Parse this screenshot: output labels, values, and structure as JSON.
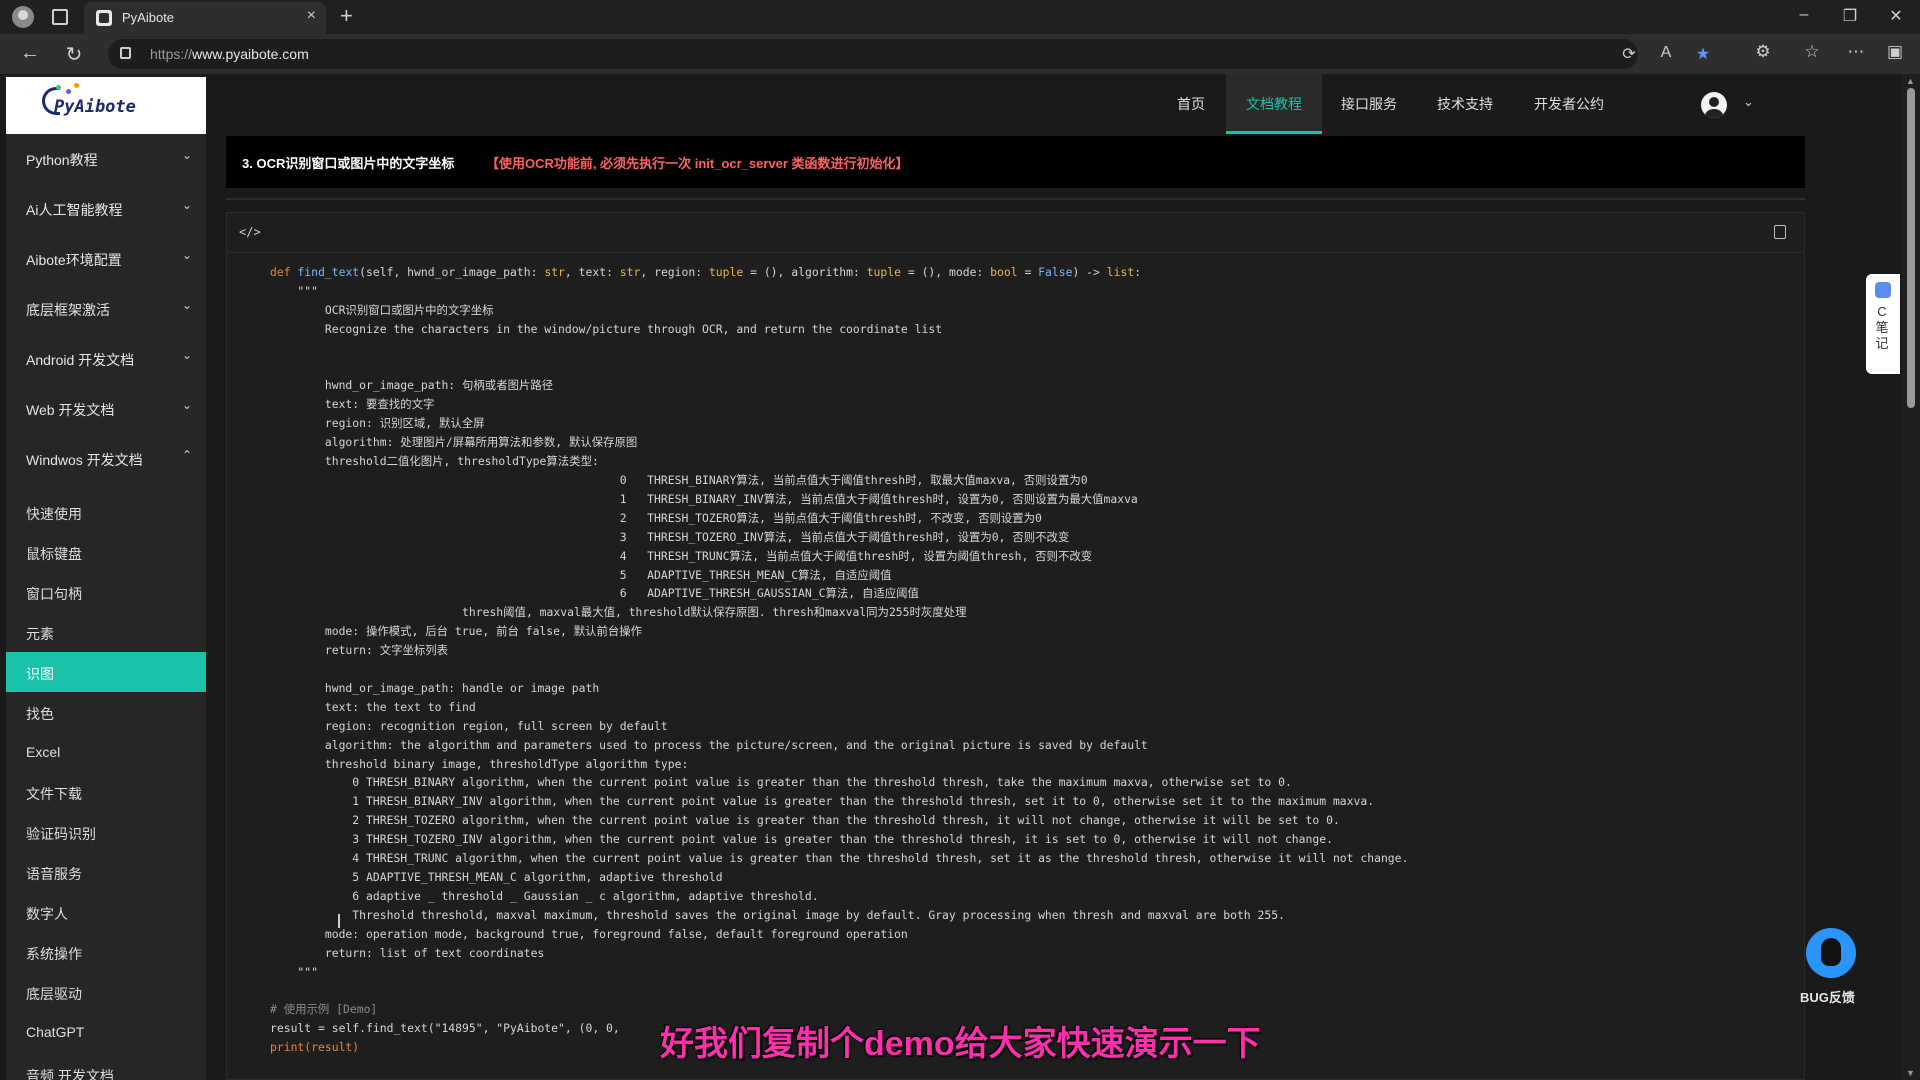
{
  "browser": {
    "tab_title": "PyAibote",
    "url_prefix": "https://",
    "url_domain": "www.pyaibote.com"
  },
  "site": {
    "logo_text": "PyAibote",
    "nav": [
      "首页",
      "文档教程",
      "接口服务",
      "技术支持",
      "开发者公约"
    ],
    "nav_active": "文档教程"
  },
  "sidebar": {
    "sections": [
      {
        "label": "Python教程",
        "chevron": "⌄"
      },
      {
        "label": "Ai人工智能教程",
        "chevron": "⌄"
      },
      {
        "label": "Aibote环境配置",
        "chevron": "⌄"
      },
      {
        "label": "底层框架激活",
        "chevron": "⌄"
      },
      {
        "label": "Android 开发文档",
        "chevron": "⌄"
      },
      {
        "label": "Web 开发文档",
        "chevron": "⌄"
      },
      {
        "label": "Windwos 开发文档",
        "chevron": "⌃"
      }
    ],
    "items": [
      "快速使用",
      "鼠标键盘",
      "窗口句柄",
      "元素",
      "识图",
      "找色",
      "Excel",
      "文件下载",
      "验证码识别",
      "语音服务",
      "数字人",
      "系统操作",
      "底层驱动",
      "ChatGPT",
      "音频 开发文档"
    ],
    "active_item": "识图"
  },
  "content": {
    "section_title": "3. OCR识别窗口或图片中的文字坐标",
    "section_note": "【使用OCR功能前, 必须先执行一次 init_ocr_server 类函数进行初始化】",
    "code_lang": "</>",
    "code_lines": [
      "    \"\"\"",
      "        OCR识别窗口或图片中的文字坐标",
      "        Recognize the characters in the window/picture through OCR, and return the coordinate list",
      "",
      "",
      "        hwnd_or_image_path: 句柄或者图片路径",
      "        text: 要查找的文字",
      "        region: 识别区域, 默认全屏",
      "        algorithm: 处理图片/屏幕所用算法和参数, 默认保存原图",
      "        threshold二值化图片, thresholdType算法类型:",
      "                                                   0   THRESH_BINARY算法, 当前点值大于阈值thresh时, 取最大值maxva, 否则设置为0",
      "                                                   1   THRESH_BINARY_INV算法, 当前点值大于阈值thresh时, 设置为0, 否则设置为最大值maxva",
      "                                                   2   THRESH_TOZERO算法, 当前点值大于阈值thresh时, 不改变, 否则设置为0",
      "                                                   3   THRESH_TOZERO_INV算法, 当前点值大于阈值thresh时, 设置为0, 否则不改变",
      "                                                   4   THRESH_TRUNC算法, 当前点值大于阈值thresh时, 设置为阈值thresh, 否则不改变",
      "                                                   5   ADAPTIVE_THRESH_MEAN_C算法, 自适应阈值",
      "                                                   6   ADAPTIVE_THRESH_GAUSSIAN_C算法, 自适应阈值",
      "                            thresh阈值, maxval最大值, threshold默认保存原图. thresh和maxval同为255时灰度处理",
      "        mode: 操作模式, 后台 true, 前台 false, 默认前台操作",
      "        return: 文字坐标列表",
      "",
      "        hwnd_or_image_path: handle or image path",
      "        text: the text to find",
      "        region: recognition region, full screen by default",
      "        algorithm: the algorithm and parameters used to process the picture/screen, and the original picture is saved by default",
      "        threshold binary image, thresholdType algorithm type:",
      "            0 THRESH_BINARY algorithm, when the current point value is greater than the threshold thresh, take the maximum maxva, otherwise set to 0.",
      "            1 THRESH_BINARY_INV algorithm, when the current point value is greater than the threshold thresh, set it to 0, otherwise set it to the maximum maxva.",
      "            2 THRESH_TOZERO algorithm, when the current point value is greater than the threshold thresh, it will not change, otherwise it will be set to 0.",
      "            3 THRESH_TOZERO_INV algorithm, when the current point value is greater than the threshold thresh, it is set to 0, otherwise it will not change.",
      "            4 THRESH_TRUNC algorithm, when the current point value is greater than the threshold thresh, set it as the threshold thresh, otherwise it will not change.",
      "            5 ADAPTIVE_THRESH_MEAN_C algorithm, adaptive threshold",
      "            6 adaptive _ threshold _ Gaussian _ c algorithm, adaptive threshold.",
      "            Threshold threshold, maxval maximum, threshold saves the original image by default. Gray processing when thresh and maxval are both 255.",
      "        mode: operation mode, background true, foreground false, default foreground operation",
      "        return: list of text coordinates",
      "    \"\"\"",
      ""
    ],
    "code_signature": {
      "kw_def": "def",
      "fn_name": "find_text",
      "params": "(self, hwnd_or_image_path: str, text: str, region: tuple = (), algorithm: tuple = (), mode: bool = False) -> list:"
    },
    "demo_comment": "# 使用示例 [Demo]",
    "demo_line": "result = self.find_text(\"14895\", \"PyAibote\", (0, 0,",
    "print_line": "print(result)"
  },
  "widgets": {
    "note_text": "C笔记",
    "bug_label": "BUG反馈"
  },
  "subtitle": "好我们复制个demo给大家快速演示一下",
  "colors": {
    "accent": "#18c3a8",
    "warning": "#ff6161",
    "subtitle": "#ff2fae"
  }
}
